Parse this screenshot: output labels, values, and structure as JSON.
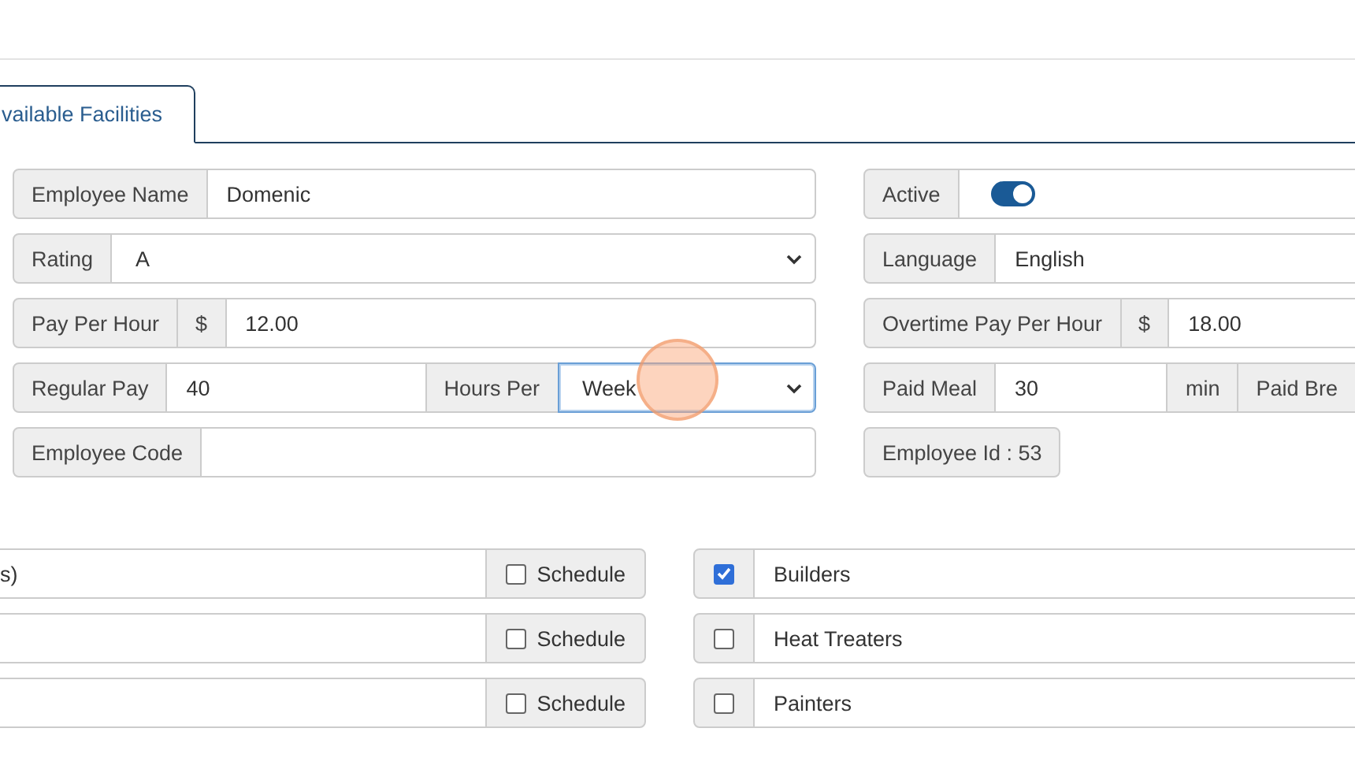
{
  "tabs": [
    {
      "label": "vailable Facilities",
      "selected": true
    }
  ],
  "left_fields": [
    {
      "parts": [
        {
          "kind": "label",
          "text": "Employee Name"
        },
        {
          "kind": "input",
          "value": "Domenic"
        }
      ]
    },
    {
      "parts": [
        {
          "kind": "label",
          "text": "Rating"
        },
        {
          "kind": "select",
          "value": "A",
          "focused": false
        }
      ]
    },
    {
      "parts": [
        {
          "kind": "label",
          "text": "Pay Per Hour"
        },
        {
          "kind": "addon",
          "text": "$"
        },
        {
          "kind": "input",
          "value": "12.00"
        }
      ]
    },
    {
      "parts": [
        {
          "kind": "label",
          "text": "Regular Pay"
        },
        {
          "kind": "input",
          "value": "40"
        },
        {
          "kind": "addon",
          "text": "Hours Per"
        },
        {
          "kind": "select",
          "value": "Week",
          "focused": true
        }
      ]
    },
    {
      "parts": [
        {
          "kind": "label",
          "text": "Employee Code"
        },
        {
          "kind": "input"
        }
      ]
    }
  ],
  "right_fields": [
    {
      "parts": [
        {
          "kind": "label",
          "text": "Active"
        },
        {
          "kind": "toggle",
          "on": true
        }
      ]
    },
    {
      "parts": [
        {
          "kind": "label",
          "text": "Language"
        },
        {
          "kind": "input",
          "value": "English"
        }
      ]
    },
    {
      "parts": [
        {
          "kind": "label",
          "text": "Overtime Pay Per Hour"
        },
        {
          "kind": "addon",
          "text": "$"
        },
        {
          "kind": "input",
          "value": "18.00"
        }
      ]
    },
    {
      "parts": [
        {
          "kind": "label",
          "text": "Paid Meal"
        },
        {
          "kind": "input",
          "value": "30"
        },
        {
          "kind": "addon",
          "text": "min"
        },
        {
          "kind": "addon",
          "text": "Paid Bre"
        }
      ]
    },
    {
      "parts": [
        {
          "kind": "label",
          "text": "Employee Id : 53"
        }
      ]
    }
  ],
  "schedule_rows": [
    {
      "value": "s)",
      "schedule_label": "Schedule",
      "schedule": false
    },
    {
      "schedule_label": "Schedule",
      "schedule": false
    },
    {
      "schedule_label": "Schedule",
      "schedule": false
    }
  ],
  "facilities": [
    {
      "name": "Builders",
      "checked": true
    },
    {
      "name": "Heat Treaters",
      "checked": false
    },
    {
      "name": "Painters",
      "checked": false
    }
  ]
}
